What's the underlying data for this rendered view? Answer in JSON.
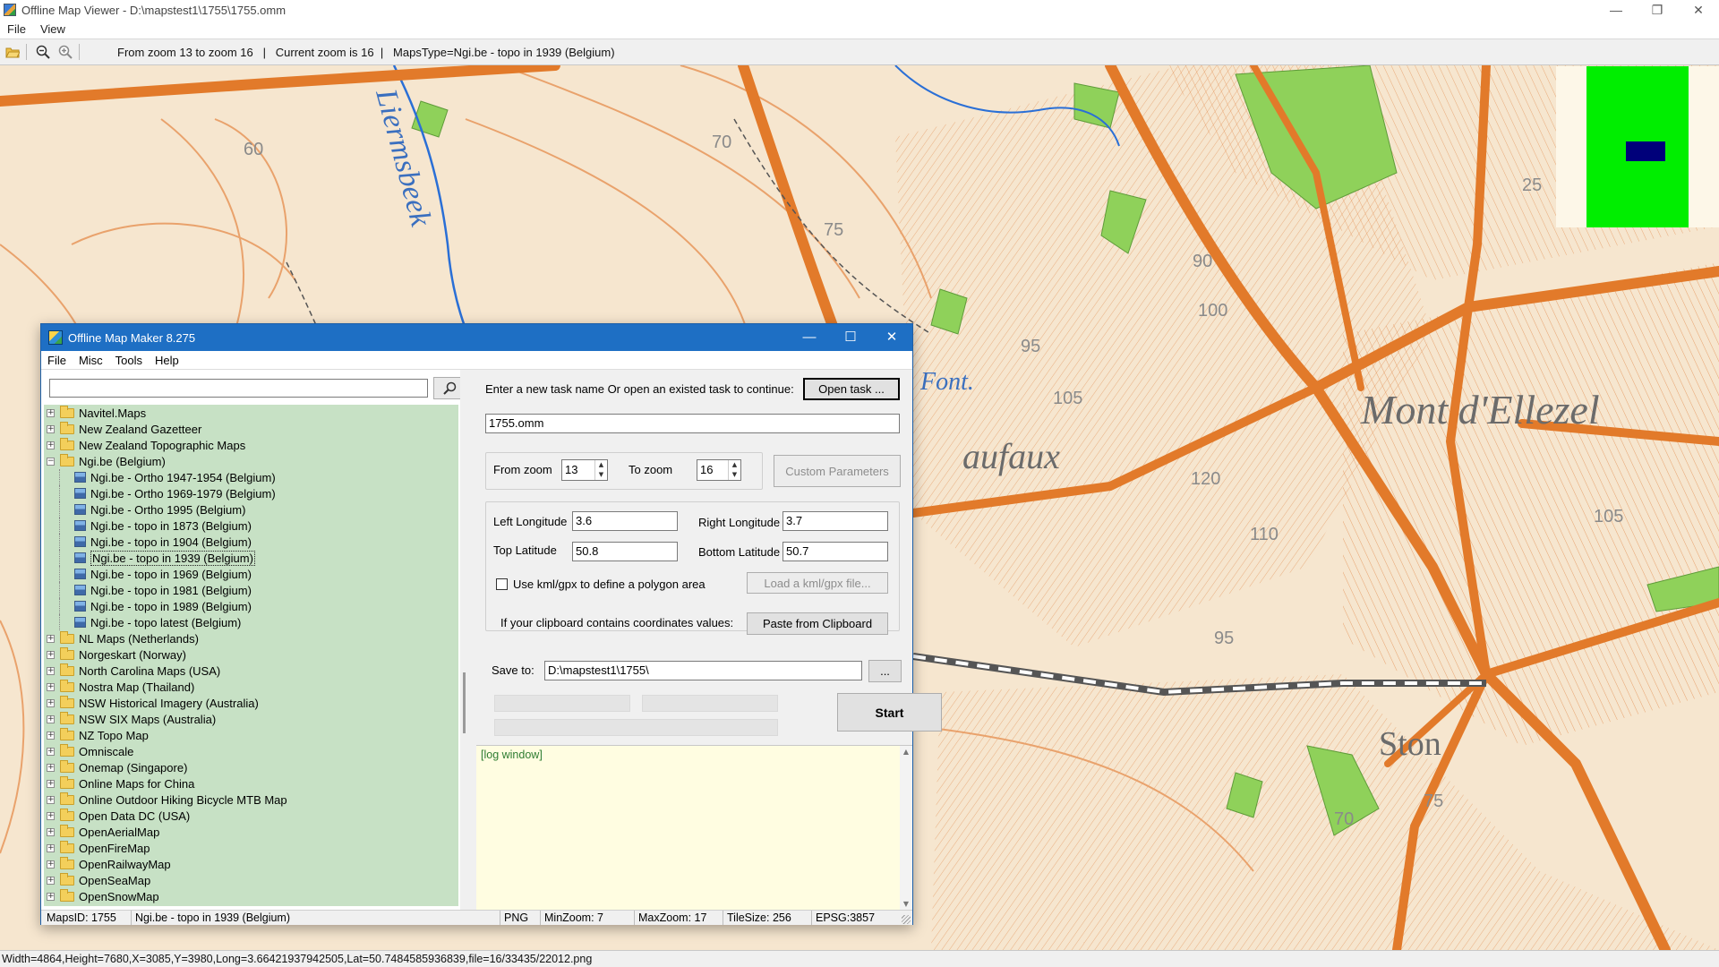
{
  "viewer": {
    "title": "Offline Map Viewer - D:\\mapstest1\\1755\\1755.omm",
    "menu": [
      "File",
      "View"
    ],
    "window_controls": {
      "minimize": "—",
      "restore": "❐",
      "close": "✕"
    },
    "toolbar": {
      "info": "From zoom 13 to zoom 16   |   Current zoom is 16  |   MapsType=Ngi.be - topo in 1939 (Belgium)"
    },
    "status": "Width=4864,Height=7680,X=3085,Y=3980,Long=3.66421937942505,Lat=50.7484585936839,file=16/33435/22012.png"
  },
  "map_labels": {
    "stream": "Liermsbeek",
    "place_1": "Mont d'Ellezel",
    "place_2": "aufaux",
    "place_3": "Font.",
    "place_4": "Ston",
    "contours": [
      "60",
      "70",
      "75",
      "90",
      "100",
      "95",
      "105",
      "120",
      "110",
      "95",
      "75",
      "70",
      "25",
      "105"
    ]
  },
  "dialog": {
    "title": "Offline Map Maker 8.275",
    "window_controls": {
      "minimize": "—",
      "maximize": "☐",
      "close": "✕"
    },
    "menu": [
      "File",
      "Misc",
      "Tools",
      "Help"
    ],
    "search": {
      "value": "",
      "icon": "magnifier-icon"
    },
    "tree": [
      {
        "label": "Navitel.Maps",
        "type": "folder",
        "expanded": false
      },
      {
        "label": "New Zealand Gazetteer",
        "type": "folder",
        "expanded": false
      },
      {
        "label": "New Zealand Topographic Maps",
        "type": "folder",
        "expanded": false
      },
      {
        "label": "Ngi.be (Belgium)",
        "type": "folder",
        "expanded": true
      },
      {
        "label": "Ngi.be - Ortho 1947-1954 (Belgium)",
        "type": "map"
      },
      {
        "label": "Ngi.be - Ortho 1969-1979 (Belgium)",
        "type": "map"
      },
      {
        "label": "Ngi.be - Ortho 1995 (Belgium)",
        "type": "map"
      },
      {
        "label": "Ngi.be - topo in 1873 (Belgium)",
        "type": "map"
      },
      {
        "label": "Ngi.be - topo in 1904 (Belgium)",
        "type": "map"
      },
      {
        "label": "Ngi.be - topo in 1939 (Belgium)",
        "type": "map",
        "selected": true
      },
      {
        "label": "Ngi.be - topo in 1969 (Belgium)",
        "type": "map"
      },
      {
        "label": "Ngi.be - topo in 1981 (Belgium)",
        "type": "map"
      },
      {
        "label": "Ngi.be - topo in 1989 (Belgium)",
        "type": "map"
      },
      {
        "label": "Ngi.be - topo latest (Belgium)",
        "type": "map"
      },
      {
        "label": "NL Maps (Netherlands)",
        "type": "folder",
        "expanded": false
      },
      {
        "label": "Norgeskart (Norway)",
        "type": "folder",
        "expanded": false
      },
      {
        "label": "North Carolina Maps (USA)",
        "type": "folder",
        "expanded": false
      },
      {
        "label": "Nostra Map (Thailand)",
        "type": "folder",
        "expanded": false
      },
      {
        "label": "NSW Historical Imagery (Australia)",
        "type": "folder",
        "expanded": false
      },
      {
        "label": "NSW SIX Maps (Australia)",
        "type": "folder",
        "expanded": false
      },
      {
        "label": "NZ Topo Map",
        "type": "folder",
        "expanded": false
      },
      {
        "label": "Omniscale",
        "type": "folder",
        "expanded": false
      },
      {
        "label": "Onemap (Singapore)",
        "type": "folder",
        "expanded": false
      },
      {
        "label": "Online Maps for China",
        "type": "folder",
        "expanded": false
      },
      {
        "label": "Online Outdoor Hiking Bicycle MTB Map",
        "type": "folder",
        "expanded": false
      },
      {
        "label": "Open Data DC (USA)",
        "type": "folder",
        "expanded": false
      },
      {
        "label": "OpenAerialMap",
        "type": "folder",
        "expanded": false
      },
      {
        "label": "OpenFireMap",
        "type": "folder",
        "expanded": false
      },
      {
        "label": "OpenRailwayMap",
        "type": "folder",
        "expanded": false
      },
      {
        "label": "OpenSeaMap",
        "type": "folder",
        "expanded": false
      },
      {
        "label": "OpenSnowMap",
        "type": "folder",
        "expanded": false
      }
    ],
    "task": {
      "prompt": "Enter a new task name Or open an existed task to continue:",
      "open_button": "Open task ...",
      "name_value": "1755.omm"
    },
    "zoom": {
      "from_label": "From zoom",
      "from_value": "13",
      "to_label": "To zoom",
      "to_value": "16",
      "custom_button": "Custom Parameters"
    },
    "coords": {
      "left_lon_label": "Left Longitude",
      "left_lon_value": "3.6",
      "right_lon_label": "Right Longitude",
      "right_lon_value": "3.7",
      "top_lat_label": "Top Latitude",
      "top_lat_value": "50.8",
      "bottom_lat_label": "Bottom Latitude",
      "bottom_lat_value": "50.7",
      "kml_checkbox_label": "Use kml/gpx to define a polygon area",
      "kml_checked": false,
      "kml_button": "Load a kml/gpx file...",
      "clipboard_label": "If your clipboard contains coordinates values:",
      "clipboard_button": "Paste from Clipboard"
    },
    "save": {
      "label": "Save to:",
      "path": "D:\\mapstest1\\1755\\",
      "browse_button": "..."
    },
    "start_button": "Start",
    "log": "[log window]",
    "status": {
      "maps_id": "MapsID: 1755",
      "map_name": "Ngi.be - topo in 1939 (Belgium)",
      "format": "PNG",
      "min_zoom": "MinZoom: 7",
      "max_zoom": "MaxZoom: 17",
      "tile_size": "TileSize: 256",
      "epsg": "EPSG:3857"
    }
  },
  "colors": {
    "map_bg": "#f6e6cf",
    "road": "#e27a2a",
    "contour": "#e9a26c",
    "tree_bg": "#c7e1c5",
    "log_bg": "#fffde1",
    "dialog_title": "#1e6fc4",
    "minimap_green": "#00ee00",
    "minimap_blue": "#00007a"
  }
}
